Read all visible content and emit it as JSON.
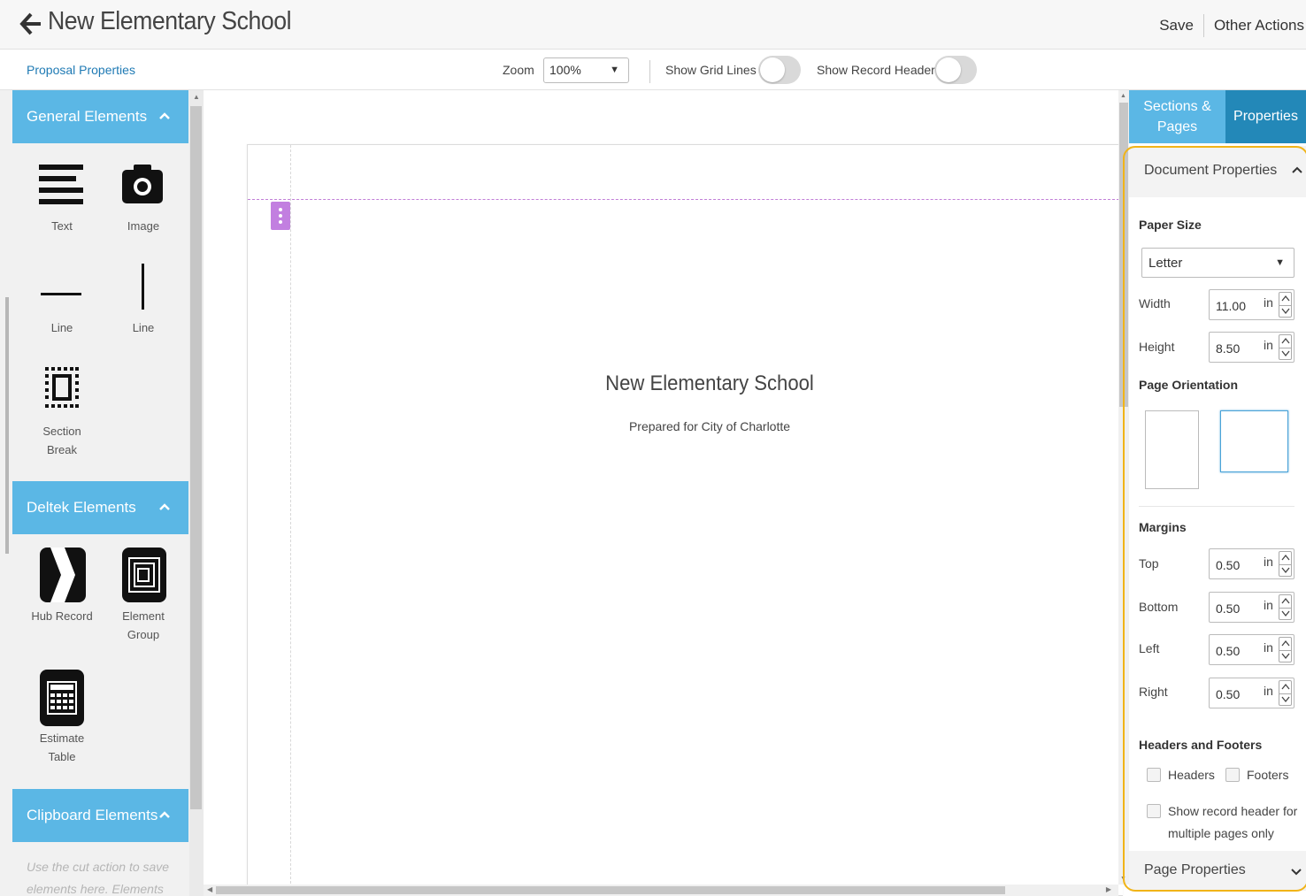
{
  "header": {
    "title": "New Elementary School",
    "save_label": "Save",
    "other_actions_label": "Other Actions"
  },
  "toolbar": {
    "proposal_properties_link": "Proposal Properties",
    "zoom_label": "Zoom",
    "zoom_value": "100%",
    "show_grid_lines_label": "Show Grid Lines",
    "show_grid_lines_on": false,
    "show_record_header_label": "Show Record Header",
    "show_record_header_on": false
  },
  "left_panel": {
    "general": {
      "title": "General Elements",
      "items": [
        {
          "label": "Text",
          "icon": "text-icon"
        },
        {
          "label": "Image",
          "icon": "camera-icon"
        },
        {
          "label": "Line",
          "icon": "horizontal-line-icon"
        },
        {
          "label": "Line",
          "icon": "vertical-line-icon"
        },
        {
          "label_line1": "Section",
          "label_line2": "Break",
          "icon": "section-break-icon"
        }
      ]
    },
    "deltek": {
      "title": "Deltek Elements",
      "items": [
        {
          "label": "Hub Record",
          "icon": "hub-record-icon"
        },
        {
          "label_line1": "Element",
          "label_line2": "Group",
          "icon": "element-group-icon"
        },
        {
          "label_line1": "Estimate",
          "label_line2": "Table",
          "icon": "estimate-table-icon"
        }
      ]
    },
    "clipboard": {
      "title": "Clipboard Elements",
      "note": "Use the cut action to save elements here. Elements can"
    }
  },
  "canvas": {
    "heading": "New Elementary School",
    "subheading": "Prepared for City of Charlotte"
  },
  "right_panel": {
    "tab_sections": "Sections & Pages",
    "tab_properties": "Properties",
    "document_properties_title": "Document Properties",
    "paper_size_label": "Paper Size",
    "paper_size_value": "Letter",
    "width_label": "Width",
    "width_value": "11.00",
    "height_label": "Height",
    "height_value": "8.50",
    "unit": "in",
    "page_orientation_label": "Page Orientation",
    "orientation_selected": "landscape",
    "margins_label": "Margins",
    "margins": [
      {
        "label": "Top",
        "value": "0.50"
      },
      {
        "label": "Bottom",
        "value": "0.50"
      },
      {
        "label": "Left",
        "value": "0.50"
      },
      {
        "label": "Right",
        "value": "0.50"
      }
    ],
    "headers_footers_label": "Headers and Footers",
    "headers_label": "Headers",
    "footers_label": "Footers",
    "record_header_line1": "Show record header for",
    "record_header_line2": "multiple pages only",
    "page_properties_title": "Page Properties"
  },
  "colors": {
    "panel_header_blue": "#5bb7e5",
    "active_tab_blue": "#2388b8",
    "link_blue": "#1f7ab4",
    "highlight_outline": "#f1b418",
    "section_handle_purple": "#c27fe0"
  }
}
